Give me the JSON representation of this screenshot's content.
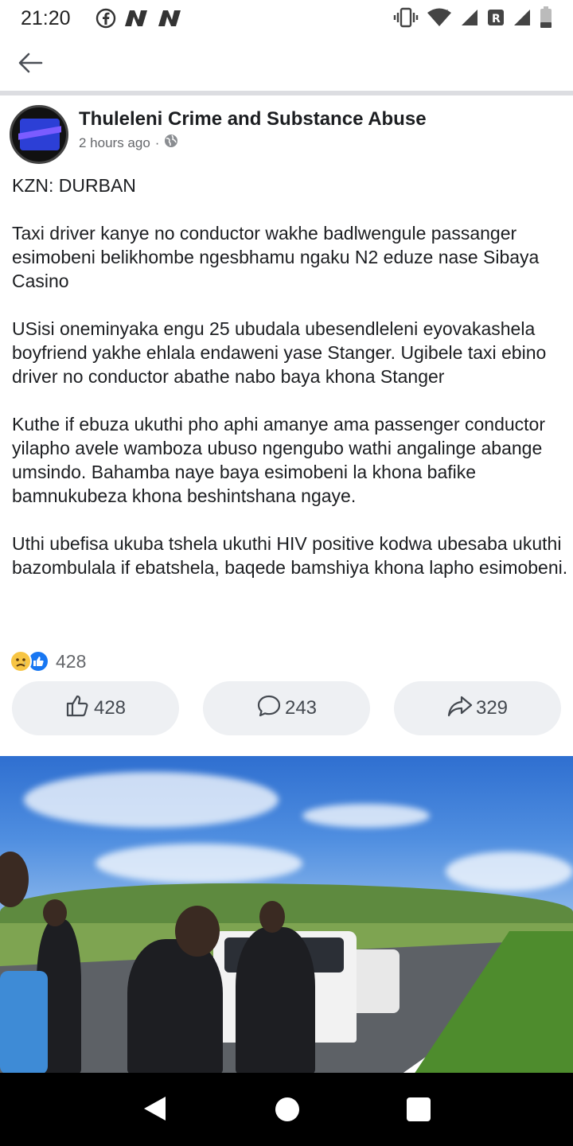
{
  "status_bar": {
    "time": "21:20",
    "left_icons": [
      "facebook-icon",
      "n-notification-icon",
      "n-notification-icon"
    ],
    "right_icons": [
      "vibrate-icon",
      "wifi-icon",
      "signal-icon",
      "roaming-r-icon",
      "signal-icon",
      "battery-icon"
    ]
  },
  "app_bar": {
    "back_icon": "arrow-left-icon"
  },
  "post": {
    "page_name": "Thuleleni Crime and Substance Abuse",
    "time_ago": "2 hours ago",
    "separator": "·",
    "audience_icon": "globe-icon",
    "paragraphs": [
      "KZN: DURBAN",
      "Taxi driver kanye no conductor wakhe badlwengule passanger esimobeni belikhombe ngesbhamu ngaku N2 eduze nase Sibaya Casino",
      "USisi oneminyaka engu 25 ubudala ubesendleleni eyovakashela boyfriend yakhe ehlala endaweni yase Stanger. Ugibele taxi ebino driver no conductor abathe nabo baya khona Stanger",
      "Kuthe if ebuza ukuthi pho aphi amanye ama passenger conductor yilapho avele wamboza ubuso ngengubo wathi angalinge abange umsindo. Bahamba naye baya esimobeni la khona bafike bamnukubeza khona beshintshana ngaye.",
      "Uthi ubefisa ukuba tshela ukuthi HIV positive kodwa ubesaba ukuthi bazombulala if ebatshela, baqede bamshiya khona lapho esimobeni."
    ],
    "reactions": {
      "icons": [
        "sad-reaction-icon",
        "like-reaction-icon"
      ],
      "count": "428"
    },
    "actions": {
      "like_count": "428",
      "comment_count": "243",
      "share_count": "329"
    }
  },
  "nav_bar": {
    "icons": [
      "back-triangle-icon",
      "home-circle-icon",
      "recents-square-icon"
    ]
  }
}
